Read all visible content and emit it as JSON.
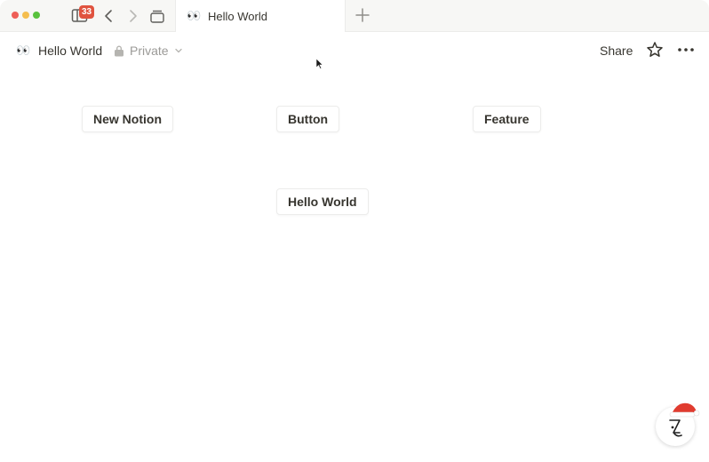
{
  "tab": {
    "emoji": "👀",
    "title": "Hello World",
    "badge_count": "33"
  },
  "header": {
    "emoji": "👀",
    "title": "Hello World",
    "privacy_label": "Private",
    "share_label": "Share"
  },
  "canvas": {
    "buttons": [
      "New Notion",
      "Button",
      "Feature",
      "Hello World"
    ]
  },
  "icons": {
    "sidebar": "sidebar-toggle-icon",
    "back": "chevron-left-icon",
    "forward": "chevron-right-icon",
    "tabs": "tab-stack-icon",
    "new_tab": "plus-icon",
    "lock": "lock-icon",
    "privacy_dropdown": "chevron-down-icon",
    "favorite": "star-icon",
    "more": "more-horizontal-icon",
    "help": "help-assistant-icon"
  },
  "colors": {
    "badge": "#e0533f",
    "text": "#37352f",
    "muted_text": "#9b9a97",
    "santa_hat": "#e03b2f"
  }
}
